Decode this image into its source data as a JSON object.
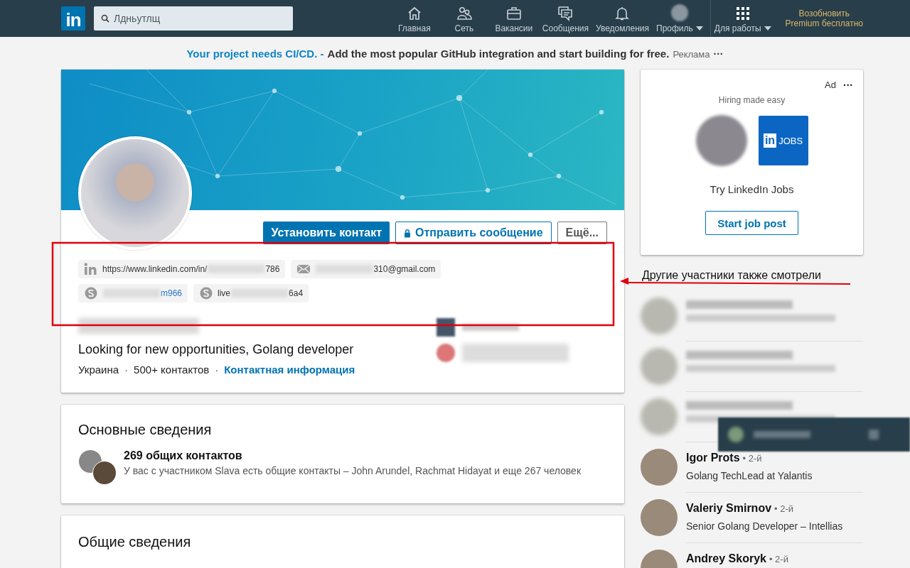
{
  "nav": {
    "logo": "in",
    "search": {
      "placeholder": "Лдньутлщ"
    },
    "items": [
      {
        "kind": "home",
        "label": "Главная",
        "caret": false
      },
      {
        "kind": "people",
        "label": "Сеть",
        "caret": false
      },
      {
        "kind": "briefcase",
        "label": "Вакансии",
        "caret": false
      },
      {
        "kind": "chat",
        "label": "Сообщения",
        "caret": false
      },
      {
        "kind": "bell",
        "label": "Уведомления",
        "caret": false
      },
      {
        "kind": "profile",
        "label": "Профиль",
        "caret": true
      },
      {
        "kind": "apps",
        "label": "Для работы",
        "caret": true
      }
    ],
    "premium": [
      "Возобновить",
      "Premium бесплатно"
    ]
  },
  "ad_banner": {
    "link": "Your project needs CI/CD. -",
    "text": "Add the most popular GitHub integration and start building for free.",
    "tag": "Реклама",
    "menu": "···"
  },
  "profile": {
    "buttons": [
      {
        "kind": "primary",
        "label": "Установить контакт"
      },
      {
        "kind": "message",
        "label": "Отправить сообщение"
      },
      {
        "kind": "more",
        "label": "Ещё..."
      }
    ],
    "contacts": [
      {
        "kind": "linkedin",
        "start": "https://www.linkedin.com/in/",
        "end": "786",
        "link": false
      },
      {
        "kind": "email",
        "end": "310@gmail.com",
        "link": false
      },
      {
        "kind": "skype",
        "end": "m966",
        "link": true
      },
      {
        "kind": "skype",
        "start": "live",
        "end": "6a4",
        "link": false
      }
    ],
    "headline": "Looking for new opportunities, Golang developer",
    "location": "Украина",
    "separator": "·",
    "connections": "500+ контактов",
    "contact_info": "Контактная информация"
  },
  "highlights": {
    "title": "Основные сведения",
    "heading": "269 общих контактов",
    "text": "У вас с участником Slava есть общие контакты – John Arundel, Rachmat Hidayat и еще 267 человек"
  },
  "about": {
    "title": "Общие сведения"
  },
  "side_ad": {
    "tag": "Ad",
    "menu": "···",
    "subtitle": "Hiring made easy",
    "logo": "in",
    "logo_text": "JOBS",
    "title": "Try LinkedIn Jobs",
    "button": "Start job post"
  },
  "viewers": {
    "title": "Другие участники также смотрели",
    "people": [
      {
        "kind": "blurred"
      },
      {
        "kind": "blurred"
      },
      {
        "kind": "blurred"
      },
      {
        "kind": "person",
        "name": "Igor Prots",
        "degree": "• 2-й",
        "title": "Golang TechLead at Yalantis"
      },
      {
        "kind": "person",
        "name": "Valeriy Smirnov",
        "degree": "• 2-й",
        "title": "Senior Golang Developer – Intellias"
      },
      {
        "kind": "person",
        "name": "Andrey Skoryk",
        "degree": "• 2-й"
      }
    ]
  }
}
